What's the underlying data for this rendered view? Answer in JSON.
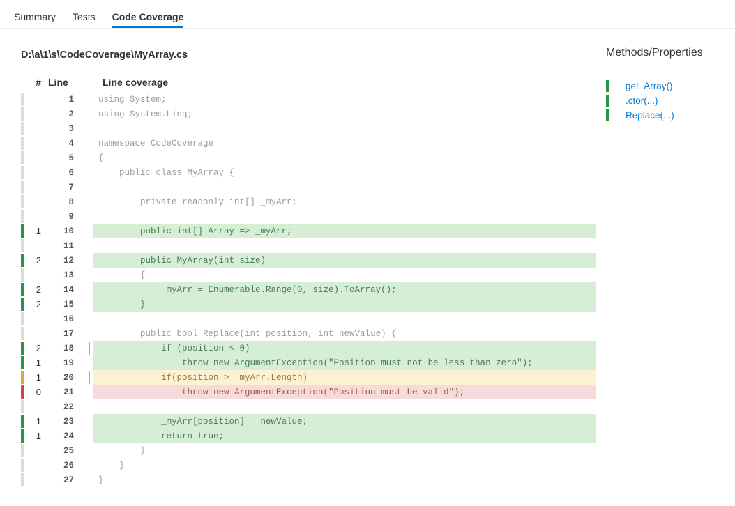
{
  "tabs": {
    "summary": "Summary",
    "tests": "Tests",
    "coverage": "Code Coverage"
  },
  "file_path": "D:\\a\\1\\s\\CodeCoverage\\MyArray.cs",
  "headers": {
    "hits": "#",
    "line": "Line",
    "code": "Line coverage"
  },
  "sidebar": {
    "title": "Methods/Properties",
    "items": [
      {
        "label": "get_Array()"
      },
      {
        "label": ".ctor(...)"
      },
      {
        "label": "Replace(...)"
      }
    ]
  },
  "lines": [
    {
      "n": 1,
      "hits": "",
      "bar": "grey",
      "branch": false,
      "hl": "",
      "code": "using System;"
    },
    {
      "n": 2,
      "hits": "",
      "bar": "grey",
      "branch": false,
      "hl": "",
      "code": "using System.Linq;"
    },
    {
      "n": 3,
      "hits": "",
      "bar": "grey",
      "branch": false,
      "hl": "",
      "code": ""
    },
    {
      "n": 4,
      "hits": "",
      "bar": "grey",
      "branch": false,
      "hl": "",
      "code": "namespace CodeCoverage"
    },
    {
      "n": 5,
      "hits": "",
      "bar": "grey",
      "branch": false,
      "hl": "",
      "code": "{"
    },
    {
      "n": 6,
      "hits": "",
      "bar": "grey",
      "branch": false,
      "hl": "",
      "code": "    public class MyArray {"
    },
    {
      "n": 7,
      "hits": "",
      "bar": "grey",
      "branch": false,
      "hl": "",
      "code": ""
    },
    {
      "n": 8,
      "hits": "",
      "bar": "grey",
      "branch": false,
      "hl": "",
      "code": "        private readonly int[] _myArr;"
    },
    {
      "n": 9,
      "hits": "",
      "bar": "grey",
      "branch": false,
      "hl": "",
      "code": ""
    },
    {
      "n": 10,
      "hits": "1",
      "bar": "green",
      "branch": false,
      "hl": "green",
      "code": "        public int[] Array => _myArr;"
    },
    {
      "n": 11,
      "hits": "",
      "bar": "grey",
      "branch": false,
      "hl": "",
      "code": ""
    },
    {
      "n": 12,
      "hits": "2",
      "bar": "green",
      "branch": false,
      "hl": "green",
      "code": "        public MyArray(int size)"
    },
    {
      "n": 13,
      "hits": "",
      "bar": "grey",
      "branch": false,
      "hl": "",
      "code": "        {"
    },
    {
      "n": 14,
      "hits": "2",
      "bar": "green",
      "branch": false,
      "hl": "green",
      "code": "            _myArr = Enumerable.Range(0, size).ToArray();"
    },
    {
      "n": 15,
      "hits": "2",
      "bar": "green",
      "branch": false,
      "hl": "green",
      "code": "        }"
    },
    {
      "n": 16,
      "hits": "",
      "bar": "grey",
      "branch": false,
      "hl": "",
      "code": ""
    },
    {
      "n": 17,
      "hits": "",
      "bar": "grey",
      "branch": false,
      "hl": "",
      "code": "        public bool Replace(int position, int newValue) {"
    },
    {
      "n": 18,
      "hits": "2",
      "bar": "green",
      "branch": true,
      "hl": "green",
      "code": "            if (position < 0)"
    },
    {
      "n": 19,
      "hits": "1",
      "bar": "green",
      "branch": false,
      "hl": "green",
      "code": "                throw new ArgumentException(\"Position must not be less than zero\");"
    },
    {
      "n": 20,
      "hits": "1",
      "bar": "orange",
      "branch": true,
      "hl": "orange",
      "code": "            if(position > _myArr.Length)"
    },
    {
      "n": 21,
      "hits": "0",
      "bar": "red",
      "branch": false,
      "hl": "red",
      "code": "                throw new ArgumentException(\"Position must be valid\");"
    },
    {
      "n": 22,
      "hits": "",
      "bar": "grey",
      "branch": false,
      "hl": "",
      "code": ""
    },
    {
      "n": 23,
      "hits": "1",
      "bar": "green",
      "branch": false,
      "hl": "green",
      "code": "            _myArr[position] = newValue;"
    },
    {
      "n": 24,
      "hits": "1",
      "bar": "green",
      "branch": false,
      "hl": "green",
      "code": "            return true;"
    },
    {
      "n": 25,
      "hits": "",
      "bar": "grey",
      "branch": false,
      "hl": "",
      "code": "        }"
    },
    {
      "n": 26,
      "hits": "",
      "bar": "grey",
      "branch": false,
      "hl": "",
      "code": "    }"
    },
    {
      "n": 27,
      "hits": "",
      "bar": "grey",
      "branch": false,
      "hl": "",
      "code": "}"
    }
  ]
}
